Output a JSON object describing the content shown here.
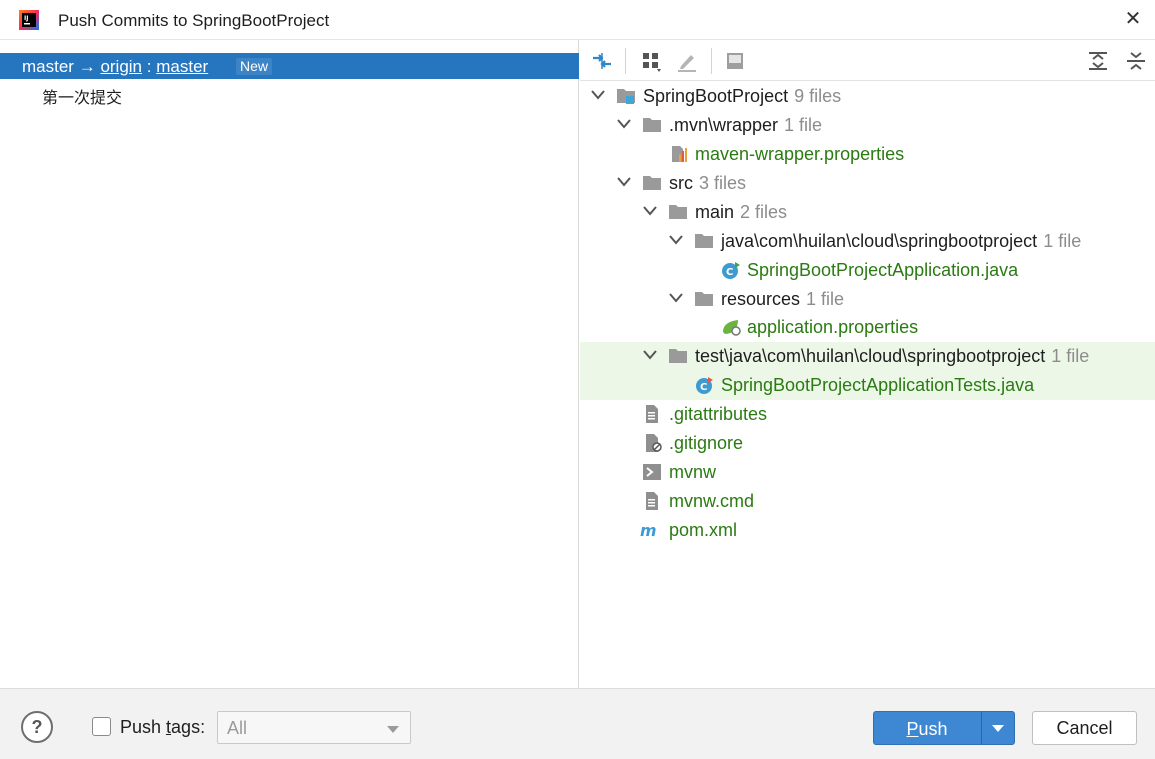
{
  "window": {
    "title": "Push Commits to SpringBootProject"
  },
  "left": {
    "branch": {
      "local": "master",
      "arrow": "→",
      "remote": "origin",
      "separator": ":",
      "remote_branch": "master",
      "badge": "New"
    },
    "commits": [
      "第一次提交"
    ]
  },
  "tree": {
    "root": {
      "label": "SpringBootProject",
      "count": "9 files"
    },
    "mvn_wrapper": {
      "label": ".mvn\\wrapper",
      "count": "1 file"
    },
    "maven_props": {
      "label": "maven-wrapper.properties"
    },
    "src": {
      "label": "src",
      "count": "3 files"
    },
    "main": {
      "label": "main",
      "count": "2 files"
    },
    "java_pkg": {
      "label": "java\\com\\huilan\\cloud\\springbootproject",
      "count": "1 file"
    },
    "app_java": {
      "label": "SpringBootProjectApplication.java"
    },
    "resources": {
      "label": "resources",
      "count": "1 file"
    },
    "app_props": {
      "label": "application.properties"
    },
    "test_pkg": {
      "label": "test\\java\\com\\huilan\\cloud\\springbootproject",
      "count": "1 file"
    },
    "tests_java": {
      "label": "SpringBootProjectApplicationTests.java"
    },
    "gitattributes": {
      "label": ".gitattributes"
    },
    "gitignore": {
      "label": ".gitignore"
    },
    "mvnw": {
      "label": "mvnw"
    },
    "mvnw_cmd": {
      "label": "mvnw.cmd"
    },
    "pom": {
      "label": "pom.xml"
    }
  },
  "bottom": {
    "help": "?",
    "push_tags_label_pre": "Push ",
    "push_tags_label_t": "t",
    "push_tags_label_post": "ags:",
    "tags_select_value": "All",
    "push_button_p": "P",
    "push_button_rest": "ush",
    "cancel_button": "Cancel"
  },
  "colors": {
    "selection": "#2675bf",
    "green_file": "#2a7b12",
    "highlight_row": "#edf7e8",
    "primary_button": "#3e88d3"
  }
}
